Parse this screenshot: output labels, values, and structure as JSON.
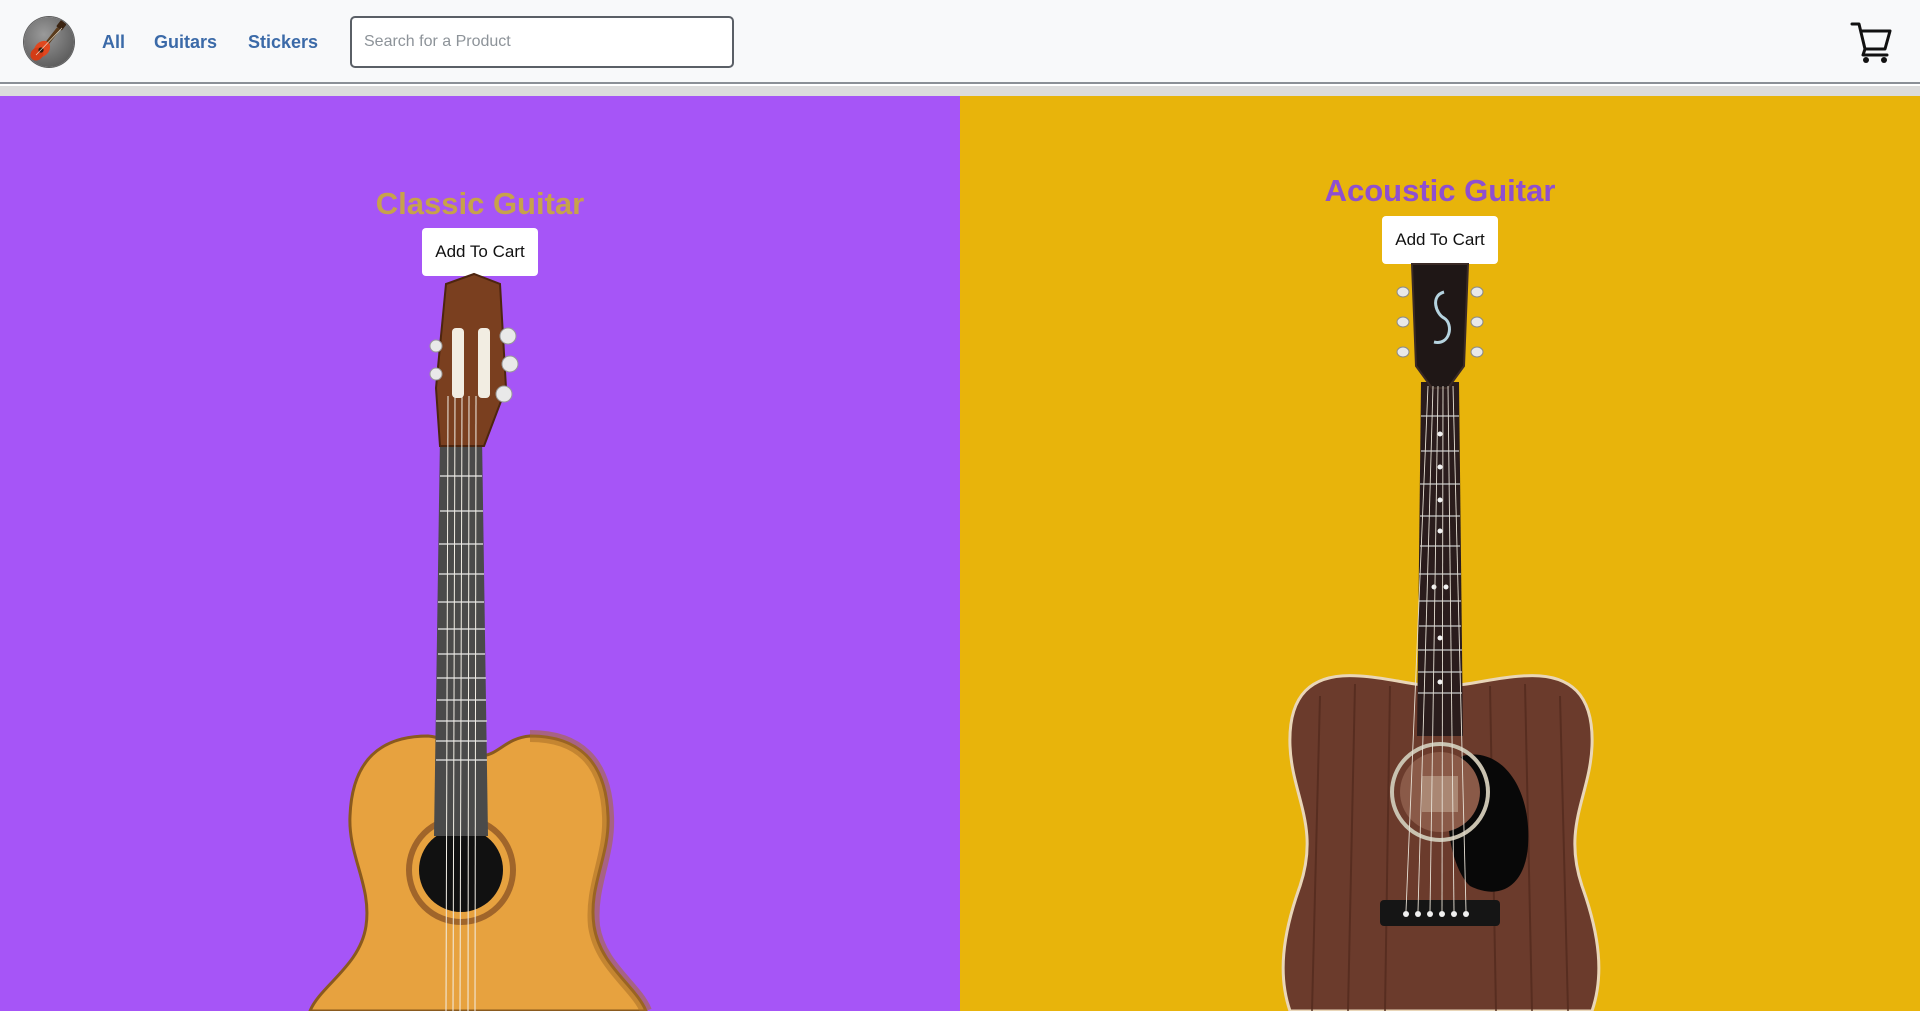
{
  "nav": {
    "links": [
      "All",
      "Guitars",
      "Stickers"
    ]
  },
  "search": {
    "placeholder": "Search for a Product",
    "value": ""
  },
  "products": [
    {
      "title": "Classic Guitar",
      "button": "Add To Cart",
      "background": "#a655f7",
      "title_color": "#c7a24a"
    },
    {
      "title": "Acoustic Guitar",
      "button": "Add To Cart",
      "background": "#e8b40b",
      "title_color": "#8e4fd0"
    }
  ],
  "icons": {
    "logo": "guitar-logo-icon",
    "cart": "shopping-cart-icon"
  }
}
